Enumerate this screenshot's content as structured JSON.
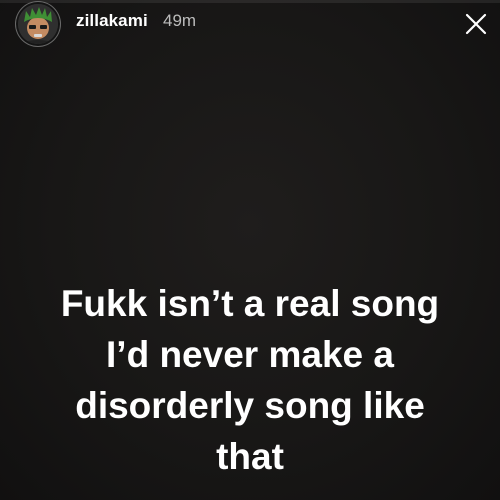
{
  "story": {
    "username": "zillakami",
    "timestamp": "49m",
    "caption_lines": [
      "Fukk isn’t a real song",
      "I’d never make a",
      "disorderly song like",
      "that"
    ]
  },
  "icons": {
    "avatar": "profile-photo",
    "close": "close-icon"
  },
  "colors": {
    "background": "#181716",
    "text": "#ffffff",
    "timestamp": "#bcbcbc",
    "avatar_hair": "#3f8f35"
  }
}
